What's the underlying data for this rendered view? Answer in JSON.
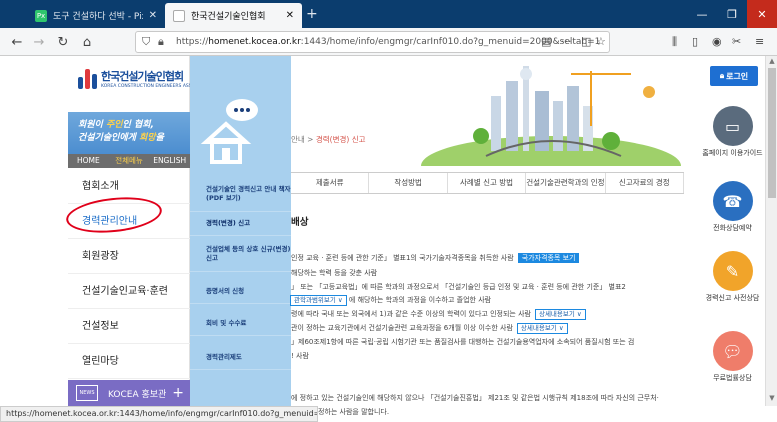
{
  "browser": {
    "tabs": [
      {
        "title": "도구 건설하다 선박 - Pixabay",
        "favicon": "Px",
        "favicon_color": "#2ec66d"
      },
      {
        "title": "한국건설기술인협회",
        "favicon": "",
        "favicon_color": "#1b4f9c"
      }
    ],
    "url_host": "homenet.kocea.or.kr",
    "url_prefix": "https://",
    "url_rest": ":1443/home/info/engmgr/carInf010.do?g_menuid=2000&seltab=1",
    "status_url": "https://homenet.kocea.or.kr:1443/home/info/engmgr/carInf010.do?g_menuid=2000&seltab=1"
  },
  "logo": {
    "ko": "한국건설기술인협회",
    "en": "KOREA CONSTRUCTION ENGINEERS ASSOCIATION"
  },
  "banner": {
    "line1a": "회원이 ",
    "line1b": "주인",
    "line1c": "인 협회,",
    "line2a": "건설기술인에게 ",
    "line2b": "희망",
    "line2c": "을"
  },
  "topnav": [
    "HOME",
    "전체메뉴",
    "ENGLISH"
  ],
  "menu": [
    "협회소개",
    "경력관리안내",
    "회원광장",
    "건설기술인교육·훈련",
    "건설정보",
    "열린마당"
  ],
  "promo": {
    "news": "NEWS",
    "label": "KOCEA 홍보관",
    "plus": "+"
  },
  "submenu": [
    "건설기술인 경력신고 안내 책자 (PDF 보기)",
    "경력(변경) 신고",
    "건설업체 등의 상호 신규(변경) 신고",
    "증명서의 신청",
    "회비 및 수수료",
    "경력관리제도"
  ],
  "breadcrumb": {
    "pre": "안내 > ",
    "current": "경력(변경) 신고"
  },
  "content_tabs": [
    "제출서류",
    "작성방법",
    "사례별 신고 방법",
    "건설기술관련학과의 인정",
    "신고자료의 경정"
  ],
  "section_title": "배상",
  "body": {
    "l1": "인정 교육 · 훈련 등에 관한 기준」 별표1의 국가기술자격종목을 취득한 사람",
    "l1btn": "국가자격종목 보기",
    "l2": "해당하는 학력 등을 갖춘 사람",
    "l3": "」 또는 「고등교육법」에 따른 학과의 과정으로서 「건설기술인 등급 인정 및 교육 · 훈련 등에 관한 기준」 별표2",
    "l4btn": "관학과범위보기 ∨",
    "l4": "에 해당하는 학과의 과정을 이수하고 졸업한 사람",
    "l5": "령에 따라 국내 또는 외국에서 1)과 같은 수준 이상의 학력이 있다고 인정되는 사람",
    "l5btn": "상세내용보기 ∨",
    "l6": "관이 정하는 교육기관에서 건설기술관련 교육과정을 6개월 이상 이수한 사람",
    "l6btn": "상세내용보기 ∨",
    "l7": "」제60조제1항에 따른 국립·공립 시험기관 또는 품질검사를 대행하는 건설기술용역업자에 소속되어 품질시험 또는 검",
    "l8": "! 사람",
    "foot": "정하는 사람을 말합니다.",
    "foot2": "에 정하고 있는 건설기술인에 해당하지 않으나 「건설기술진흥법」 제21조 및 같은법 시행규칙 제18조에 따라 자신의 근무처·"
  },
  "quick": {
    "login": "로그인",
    "items": [
      {
        "label": "홈페이지 이용가이드",
        "icon": "monitor-icon",
        "color": "#5a6b7d"
      },
      {
        "label": "전화상담예약",
        "icon": "phone-icon",
        "color": "#2a6fc0"
      },
      {
        "label": "경력신고 사전상담",
        "icon": "form-icon",
        "color": "#f1a42a"
      },
      {
        "label": "무료법률상담",
        "icon": "chat-icon",
        "color": "#ef7d6a"
      }
    ]
  }
}
